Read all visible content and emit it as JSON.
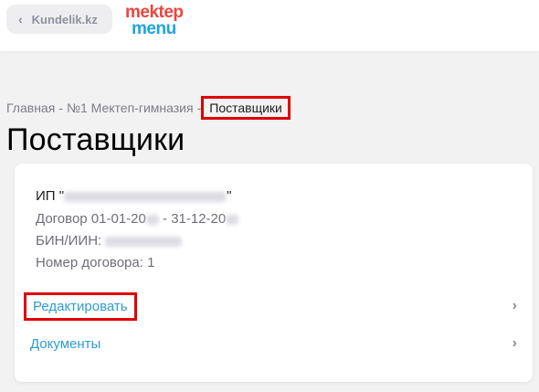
{
  "header": {
    "back_label": "Kundelik.kz",
    "back_icon": "chevron-left-icon",
    "logo_line1": "mektep",
    "logo_line2": "menu"
  },
  "breadcrumb": {
    "items": [
      "Главная",
      "№1 Мектеп-гимназия"
    ],
    "separator": "-",
    "current": "Поставщики"
  },
  "page": {
    "title": "Поставщики"
  },
  "supplier": {
    "name_prefix": "ИП \"",
    "name_suffix": "\"",
    "contract_prefix": "Договор 01-01-20",
    "contract_mid": " - 31-12-20",
    "bin_label": "БИН/ИИН: ",
    "contract_number": "Номер договора: 1"
  },
  "actions": {
    "edit_label": "Редактировать",
    "documents_label": "Документы",
    "chevron": "›"
  },
  "colors": {
    "accent": "#2d9cd2",
    "highlight": "#e00000",
    "logo_red": "#e9463f",
    "logo_blue": "#1ea4e0"
  }
}
